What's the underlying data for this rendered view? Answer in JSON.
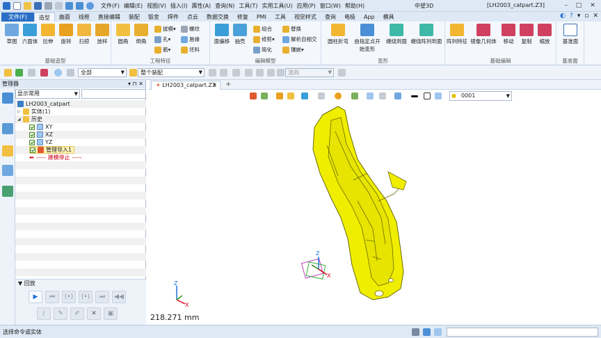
{
  "titlebar": {
    "menus": [
      "文件(F)",
      "编辑(E)",
      "视图(V)",
      "插入(I)",
      "属性(A)",
      "查询(N)",
      "工具(T)",
      "实用工具(U)",
      "应用(P)",
      "窗口(W)",
      "帮助(H)"
    ],
    "app_name": "中望3D",
    "doc_name": "[LH2003_catpart.Z3]"
  },
  "ribbon_tabs": {
    "file": "文件(F)",
    "tabs": [
      "造型",
      "曲面",
      "线框",
      "直接编辑",
      "装配",
      "钣金",
      "焊件",
      "点云",
      "数据交换",
      "修复",
      "PMI",
      "工具",
      "视觉样式",
      "查询",
      "电极",
      "App",
      "模具"
    ],
    "active": "造型"
  },
  "ribbon": {
    "groups": [
      {
        "label": "基础造型",
        "big": [
          "草图",
          "六面体",
          "拉伸",
          "旋转",
          "扫掠",
          "放样"
        ]
      },
      {
        "label": "工程特征",
        "big": [
          "圆角",
          "倒角"
        ],
        "small": [
          "拔模",
          "孔",
          "筋",
          "螺纹",
          "唇缘",
          "坯料"
        ]
      },
      {
        "label": "编辑模型",
        "big": [
          "面偏移",
          "抽壳"
        ],
        "small": [
          "组合",
          "修剪",
          "简化",
          "替换",
          "解析自相交",
          "镶嵌"
        ]
      },
      {
        "label": "变形",
        "big": [
          "圆柱折弯",
          "由指定点开始变形",
          "缠绕到面",
          "缠绕阵列到面"
        ]
      },
      {
        "label": "基础编辑",
        "big": [
          "阵列特征",
          "镜像几何体",
          "移动",
          "复制",
          "缩放"
        ]
      },
      {
        "label": "基准面",
        "big": [
          "基准面"
        ]
      }
    ]
  },
  "toolbar2": {
    "filter_all": "全部",
    "assembly_scope": "整个装配",
    "normal_dir": "法向"
  },
  "manager": {
    "title": "管理器",
    "filter": "显示常用",
    "tree": {
      "root": "LH2003_catpart",
      "solid": "实体(1)",
      "history": "历史",
      "planes": [
        "XY",
        "XZ",
        "YZ"
      ],
      "pipe_import": "管理导入1",
      "stop": "----- 建模停止 -----"
    },
    "playback_title": "回放"
  },
  "document": {
    "tab_label": "LH2003_catpart.Z3",
    "layer": "0001",
    "measure": "218.271 mm"
  },
  "status": {
    "prompt": "选择命令或实体"
  },
  "colors": {
    "accent": "#2a6fc6",
    "model": "#f0ee00",
    "model_edge": "#6a6a00"
  }
}
